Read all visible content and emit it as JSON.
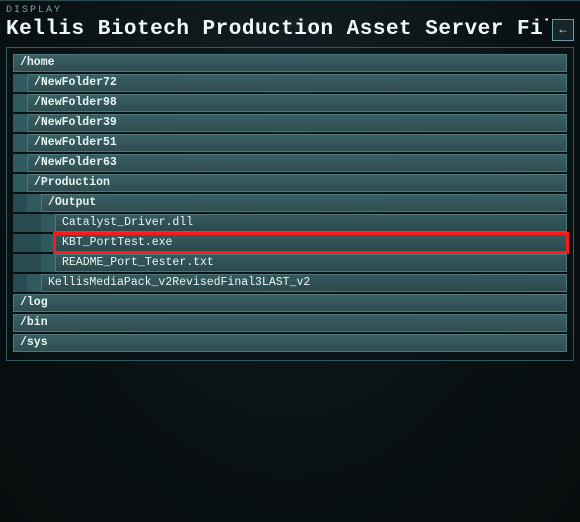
{
  "display_label": "DISPLAY",
  "title": "Kellis Biotech Production Asset Server File System",
  "back_glyph": "←",
  "tree": [
    {
      "indent": 0,
      "type": "dir",
      "label": "/home",
      "name": "dir-home"
    },
    {
      "indent": 1,
      "type": "dir",
      "label": "/NewFolder72",
      "name": "dir-newfolder72"
    },
    {
      "indent": 1,
      "type": "dir",
      "label": "/NewFolder98",
      "name": "dir-newfolder98"
    },
    {
      "indent": 1,
      "type": "dir",
      "label": "/NewFolder39",
      "name": "dir-newfolder39"
    },
    {
      "indent": 1,
      "type": "dir",
      "label": "/NewFolder51",
      "name": "dir-newfolder51"
    },
    {
      "indent": 1,
      "type": "dir",
      "label": "/NewFolder63",
      "name": "dir-newfolder63"
    },
    {
      "indent": 1,
      "type": "dir",
      "label": "/Production",
      "name": "dir-production"
    },
    {
      "indent": 2,
      "type": "dir",
      "label": "/Output",
      "name": "dir-output"
    },
    {
      "indent": 3,
      "type": "file",
      "label": "Catalyst_Driver.dll",
      "name": "file-catalyst-driver"
    },
    {
      "indent": 3,
      "type": "file",
      "label": "KBT_PortTest.exe",
      "name": "file-kbt-porttest",
      "highlight": true
    },
    {
      "indent": 3,
      "type": "file",
      "label": "README_Port_Tester.txt",
      "name": "file-readme-port-tester"
    },
    {
      "indent": 2,
      "type": "file",
      "label": "KellisMediaPack_v2RevisedFinal3LAST_v2",
      "name": "file-kellismediapack"
    },
    {
      "indent": 0,
      "type": "dir",
      "label": "/log",
      "name": "dir-log"
    },
    {
      "indent": 0,
      "type": "dir",
      "label": "/bin",
      "name": "dir-bin"
    },
    {
      "indent": 0,
      "type": "dir",
      "label": "/sys",
      "name": "dir-sys"
    }
  ]
}
